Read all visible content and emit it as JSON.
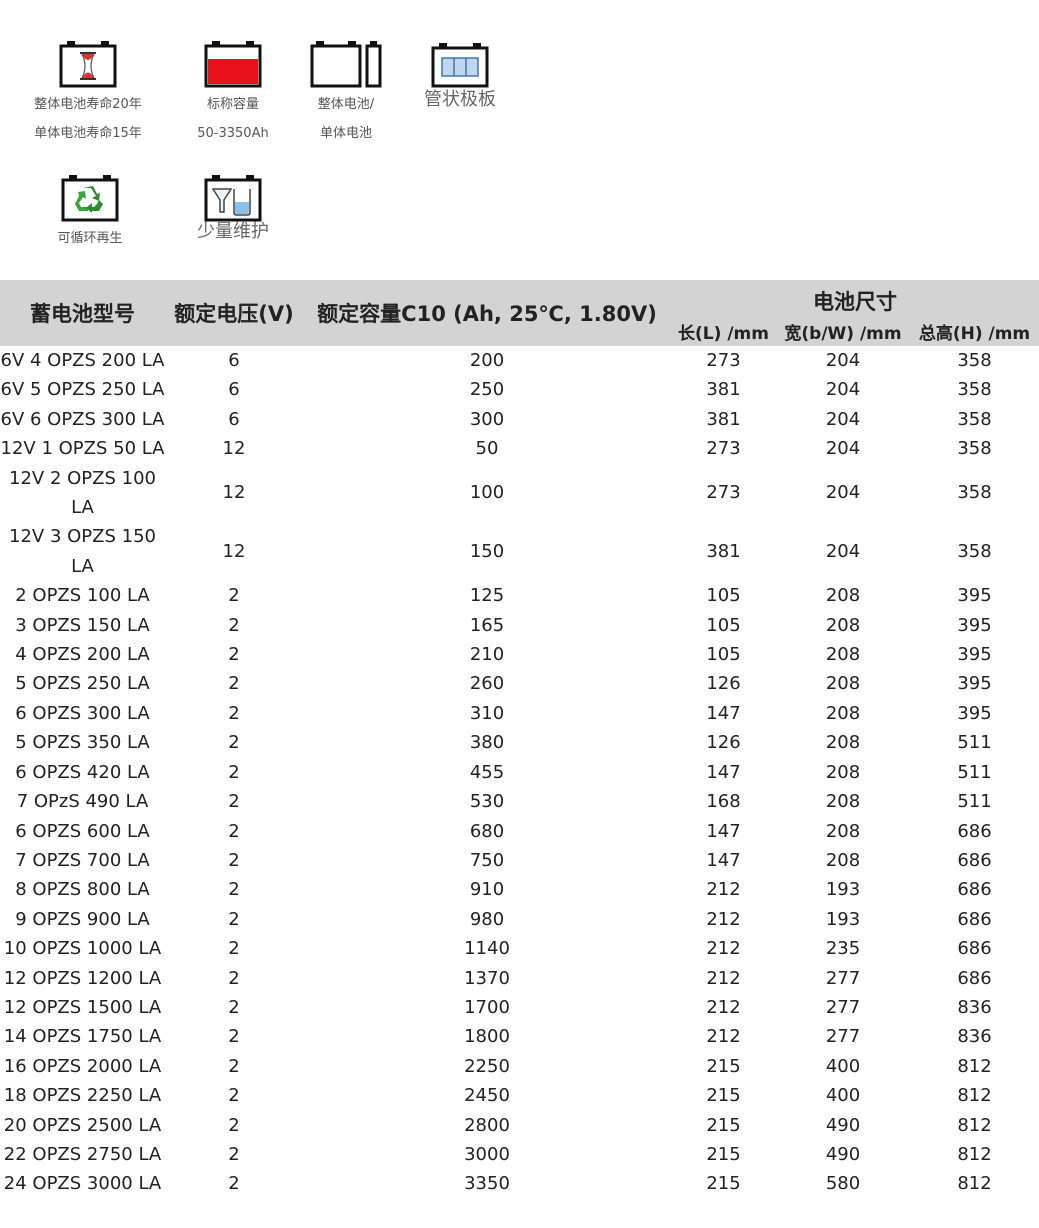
{
  "features": [
    {
      "icon": "hourglass-battery-icon",
      "lines": [
        "整体电池寿命20年",
        "单体电池寿命15年"
      ]
    },
    {
      "icon": "capacity-battery-icon",
      "lines": [
        "标称容量",
        "50-3350Ah"
      ]
    },
    {
      "icon": "single-cell-battery-icon",
      "lines": [
        "整体电池/",
        "单体电池"
      ]
    },
    {
      "icon": "tubular-plate-battery-icon",
      "lines": [
        "管状极板"
      ]
    },
    {
      "icon": "recycle-battery-icon",
      "lines": [
        "可循环再生"
      ]
    },
    {
      "icon": "funnel-maintenance-icon",
      "lines": [
        "少量维护"
      ]
    }
  ],
  "table": {
    "headers": {
      "model": "蓄电池型号",
      "voltage": "额定电压(V)",
      "capacity": "额定容量C10 (Ah, 25℃, 1.80V)",
      "dimensions": "电池尺寸",
      "length": "长(L) /mm",
      "width": "宽(b/W) /mm",
      "height": "总高(H) /mm"
    },
    "rows": [
      [
        "6V 4 OPZS 200 LA",
        "6",
        "200",
        "273",
        "204",
        "358"
      ],
      [
        "6V 5 OPZS 250 LA",
        "6",
        "250",
        "381",
        "204",
        "358"
      ],
      [
        "6V 6 OPZS 300 LA",
        "6",
        "300",
        "381",
        "204",
        "358"
      ],
      [
        "12V 1 OPZS 50 LA",
        "12",
        "50",
        "273",
        "204",
        "358"
      ],
      [
        "12V 2 OPZS 100 LA",
        "12",
        "100",
        "273",
        "204",
        "358"
      ],
      [
        "12V 3 OPZS 150 LA",
        "12",
        "150",
        "381",
        "204",
        "358"
      ],
      [
        "2 OPZS 100 LA",
        "2",
        "125",
        "105",
        "208",
        "395"
      ],
      [
        "3 OPZS 150 LA",
        "2",
        "165",
        "105",
        "208",
        "395"
      ],
      [
        "4 OPZS 200 LA",
        "2",
        "210",
        "105",
        "208",
        "395"
      ],
      [
        "5 OPZS 250 LA",
        "2",
        "260",
        "126",
        "208",
        "395"
      ],
      [
        "6 OPZS 300 LA",
        "2",
        "310",
        "147",
        "208",
        "395"
      ],
      [
        "5 OPZS 350 LA",
        "2",
        "380",
        "126",
        "208",
        "511"
      ],
      [
        "6 OPZS 420 LA",
        "2",
        "455",
        "147",
        "208",
        "511"
      ],
      [
        "7 OPzS 490 LA",
        "2",
        "530",
        "168",
        "208",
        "511"
      ],
      [
        "6 OPZS 600 LA",
        "2",
        "680",
        "147",
        "208",
        "686"
      ],
      [
        "7 OPZS 700 LA",
        "2",
        "750",
        "147",
        "208",
        "686"
      ],
      [
        "8 OPZS 800 LA",
        "2",
        "910",
        "212",
        "193",
        "686"
      ],
      [
        "9 OPZS 900 LA",
        "2",
        "980",
        "212",
        "193",
        "686"
      ],
      [
        "10 OPZS 1000 LA",
        "2",
        "1140",
        "212",
        "235",
        "686"
      ],
      [
        "12 OPZS 1200 LA",
        "2",
        "1370",
        "212",
        "277",
        "686"
      ],
      [
        "12 OPZS 1500 LA",
        "2",
        "1700",
        "212",
        "277",
        "836"
      ],
      [
        "14 OPZS 1750 LA",
        "2",
        "1800",
        "212",
        "277",
        "836"
      ],
      [
        "16 OPZS 2000 LA",
        "2",
        "2250",
        "215",
        "400",
        "812"
      ],
      [
        "18 OPZS 2250 LA",
        "2",
        "2450",
        "215",
        "400",
        "812"
      ],
      [
        "20 OPZS 2500 LA",
        "2",
        "2800",
        "215",
        "490",
        "812"
      ],
      [
        "22 OPZS 2750 LA",
        "2",
        "3000",
        "215",
        "490",
        "812"
      ],
      [
        "24 OPZS 3000 LA",
        "2",
        "3350",
        "215",
        "580",
        "812"
      ]
    ]
  }
}
